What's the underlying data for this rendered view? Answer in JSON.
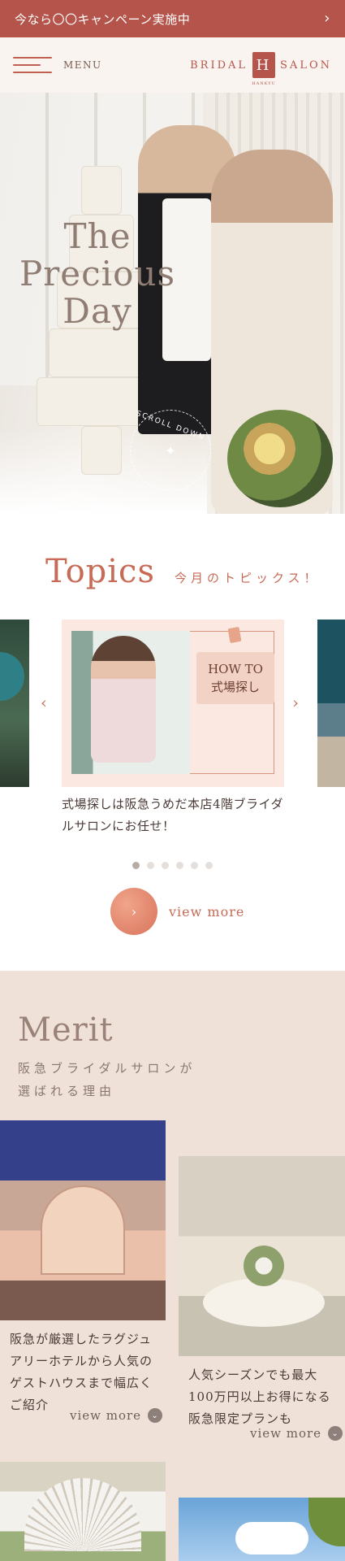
{
  "campaign": {
    "text": "今なら〇〇キャンペーン実施中",
    "chevron": "›"
  },
  "header": {
    "menu_label": "MENU",
    "logo_left": "BRIDAL",
    "logo_mark": "H",
    "logo_right": "SALON",
    "logo_sub": "HANKYU"
  },
  "hero": {
    "title_line1": "The",
    "title_line2": "Precious",
    "title_line3": "Day",
    "scroll_label": "SCROLL DOWN",
    "scroll_star": "✦"
  },
  "topics": {
    "heading_en": "Topics",
    "heading_ja": "今月のトピックス！",
    "prev_arrow": "‹",
    "next_arrow": "›",
    "card": {
      "badge_line1": "HOW TO",
      "badge_line2": "式場探し",
      "caption": "式場探しは阪急うめだ本店4階ブライダルサロンにお任せ！"
    },
    "dots_count": 6,
    "active_dot": 0,
    "view_more": "view more",
    "view_more_arrow": "›"
  },
  "merit": {
    "heading": "Merit",
    "sub_line1": "阪急ブライダルサロンが",
    "sub_line2": "選ばれる理由",
    "items": [
      {
        "text": "阪急が厳選したラグジュアリーホテルから人気のゲストハウスまで幅広くご紹介",
        "more": "view more"
      },
      {
        "text": "人気シーズンでも最大100万円以上お得になる阪急限定プランも",
        "more": "view more"
      }
    ]
  }
}
